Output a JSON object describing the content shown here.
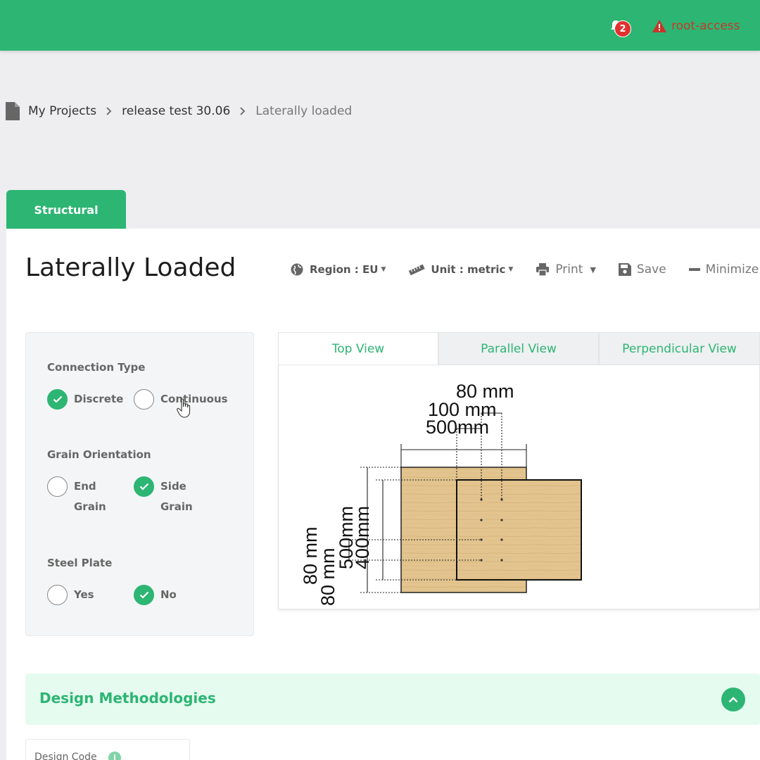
{
  "header": {
    "notification_count": "2",
    "user_label": "root-access",
    "accent_color": "#2db573"
  },
  "breadcrumb": {
    "items": [
      "My Projects",
      "release test 30.06",
      "Laterally loaded"
    ]
  },
  "tabs": {
    "structural": "Structural"
  },
  "page": {
    "title": "Laterally Loaded"
  },
  "toolbar": {
    "region_label": "Region : EU",
    "unit_label": "Unit : metric",
    "print_label": "Print",
    "save_label": "Save",
    "minimize_label": "Minimize"
  },
  "options": {
    "connection_type": {
      "label": "Connection Type",
      "choices": [
        {
          "label": "Discrete",
          "checked": true
        },
        {
          "label": "Continuous",
          "checked": false
        }
      ]
    },
    "grain_orientation": {
      "label": "Grain Orientation",
      "choices": [
        {
          "label": "End Grain",
          "line1": "End",
          "line2": "Grain",
          "checked": false
        },
        {
          "label": "Side Grain",
          "line1": "Side",
          "line2": "Grain",
          "checked": true
        }
      ]
    },
    "steel_plate": {
      "label": "Steel Plate",
      "choices": [
        {
          "label": "Yes",
          "checked": false
        },
        {
          "label": "No",
          "checked": true
        }
      ]
    }
  },
  "views": {
    "tabs": [
      "Top View",
      "Parallel View",
      "Perpendicular View"
    ],
    "active": "Top View"
  },
  "diagram": {
    "labels": {
      "top1": "80 mm",
      "top2": "100 mm",
      "top3": "500mm",
      "left1": "80 mm",
      "left2": "80 mm",
      "left3": "500mm",
      "left4": "400mm"
    },
    "wood_color": "#e3c48e"
  },
  "design": {
    "title": "Design Methodologies",
    "code_label": "Design Code",
    "info_glyph": "i"
  }
}
